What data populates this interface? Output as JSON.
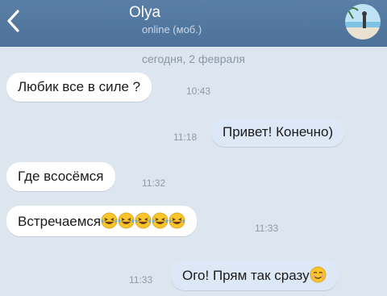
{
  "header": {
    "contact_name": "Olya",
    "status": "online (моб.)",
    "back_icon": "chevron-left-icon",
    "avatar_icon": "avatar"
  },
  "date_separator": "сегодня, 2 февраля",
  "messages": [
    {
      "direction": "incoming",
      "text": "Любик все в силе ?",
      "time": "10:43"
    },
    {
      "direction": "outgoing",
      "text": "Привет! Конечно)",
      "time": "11:18"
    },
    {
      "direction": "incoming",
      "text": "Где всосёмся",
      "time": "11:32"
    },
    {
      "direction": "incoming",
      "text": "Встречаемся",
      "time": "11:33",
      "emoji": [
        "laughing-crying-emoji",
        "laughing-crying-emoji",
        "laughing-crying-emoji",
        "laughing-crying-emoji",
        "laughing-crying-emoji"
      ]
    },
    {
      "direction": "outgoing",
      "text": "Ого! Прям так сразу",
      "time": "11:33",
      "emoji": [
        "blushing-smile-emoji"
      ]
    }
  ],
  "colors": {
    "header": "#4d729a",
    "background": "#dde5ee",
    "incoming_bubble": "#ffffff",
    "outgoing_bubble": "#dce8f5"
  }
}
